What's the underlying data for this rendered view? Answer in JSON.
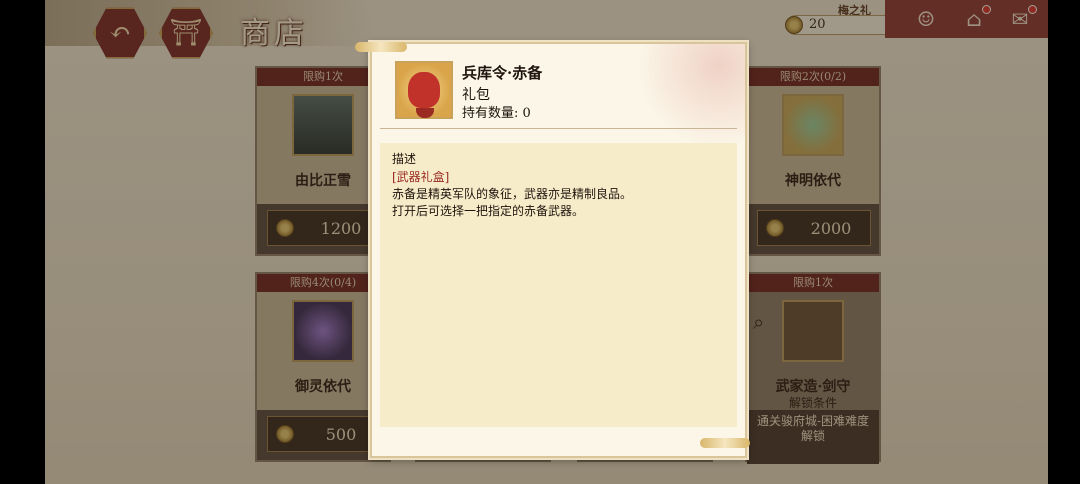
{
  "header": {
    "title": "商店",
    "back_icon": "back-arrow-icon",
    "home_icon": "shrine-home-icon",
    "currency": {
      "label": "梅之礼",
      "value": "20"
    }
  },
  "top_right": {
    "icons": [
      "character-icon",
      "home-icon",
      "mail-icon"
    ]
  },
  "shop_items": [
    {
      "limit": "限购1次",
      "name": "由比正雪",
      "price": "1200"
    },
    {
      "limit": "限购2次(0/2)",
      "name": "神明依代",
      "price": "2000"
    },
    {
      "limit": "限购4次(0/4)",
      "name": "御灵依代",
      "price": "500"
    },
    {
      "limit": "限购1次",
      "name": "武家造·剑守",
      "lock_title": "解锁条件",
      "lock_text": "通关骏府城-困难难度解锁"
    }
  ],
  "modal": {
    "item_name": "兵库令·赤备",
    "item_type": "礼包",
    "count_label": "持有数量: 0",
    "desc_heading": "描述",
    "desc_category": "[武器礼盒]",
    "desc_lines": [
      "赤备是精英军队的象征，武器亦是精制良品。",
      "打开后可选择一把指定的赤备武器。"
    ]
  },
  "colors": {
    "accent_red": "#8e3a33",
    "gold": "#c9a15a",
    "panel": "#f6ecc9"
  }
}
